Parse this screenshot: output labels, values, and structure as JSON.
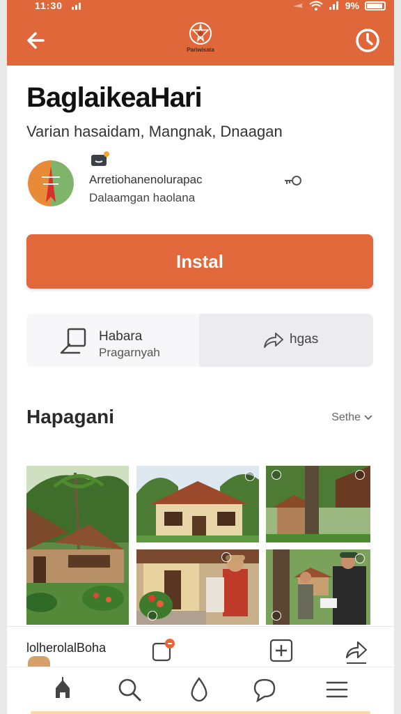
{
  "status_bar": {
    "time": "11:30",
    "battery_label": "9%",
    "battery_level": 0.9
  },
  "app_bar": {
    "logo_text": "Pariwisata"
  },
  "app": {
    "title": "BaglaikeaHari",
    "subtitle": "Varian hasaidam, Mangnak, Dnaagan",
    "developer_line1": "Arretiohanenolurapac",
    "developer_line2": "Dalaamgan haolana"
  },
  "install_button": {
    "label": "Instal"
  },
  "actions": {
    "left_line1": "Habara",
    "left_line2": "Pragarnyah",
    "right_label": "hgas"
  },
  "section": {
    "title": "Hapagani",
    "sort_label": "Sethe"
  },
  "bottom_panel": {
    "label": "lolherolalBoha"
  },
  "icons": {
    "back": "arrow-left-icon",
    "history": "clock-icon",
    "logo": "emblem-icon",
    "badge": "game-badge-icon",
    "key": "key-icon",
    "review": "pen-review-icon",
    "share": "share-icon",
    "notification": "notification-icon",
    "add": "plus-icon",
    "nav": [
      "home-icon",
      "search-icon",
      "drop-icon",
      "chat-icon",
      "menu-icon"
    ]
  },
  "colors": {
    "accent": "#e0673a",
    "button": "#e0683a",
    "text": "#111111"
  }
}
